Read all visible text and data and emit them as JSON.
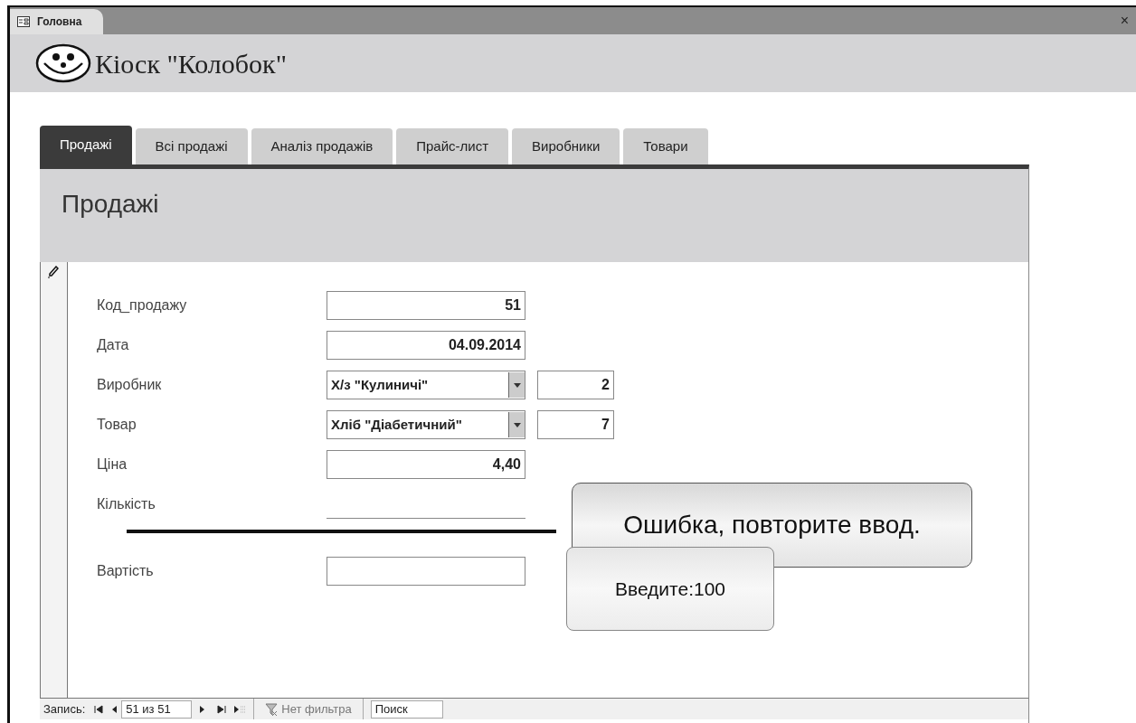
{
  "document_tab": {
    "title": "Головна"
  },
  "close_button": "×",
  "app_title": "Кіоск \"Колобок\"",
  "tabs": [
    {
      "label": "Продажі",
      "selected": true
    },
    {
      "label": "Всі продажі",
      "selected": false
    },
    {
      "label": "Аналіз продажів",
      "selected": false
    },
    {
      "label": "Прайс-лист",
      "selected": false
    },
    {
      "label": "Виробники",
      "selected": false
    },
    {
      "label": "Товари",
      "selected": false
    }
  ],
  "form": {
    "title": "Продажі",
    "fields": [
      {
        "kind": "text",
        "label": "Код_продажу",
        "value": "51"
      },
      {
        "kind": "text",
        "label": "Дата",
        "value": "04.09.2014"
      },
      {
        "kind": "combo",
        "label": "Виробник",
        "value": "Х/з \"Кулиничі\"",
        "code": "2"
      },
      {
        "kind": "combo",
        "label": "Товар",
        "value": "Хліб \"Діабетичний\"",
        "code": "7"
      },
      {
        "kind": "text",
        "label": "Ціна",
        "value": "4,40"
      },
      {
        "kind": "underline",
        "label": "Кількість"
      },
      {
        "kind": "rule"
      },
      {
        "kind": "text",
        "label": "Вартість"
      }
    ]
  },
  "messages": [
    {
      "kind": "error",
      "text": "Ошибка, повторите ввод."
    },
    {
      "kind": "hint",
      "text": "Введите:100"
    }
  ],
  "record_nav": {
    "label": "Запись:",
    "position": "51 из 51",
    "filter": "Нет фильтра",
    "search_placeholder": "Поиск"
  }
}
